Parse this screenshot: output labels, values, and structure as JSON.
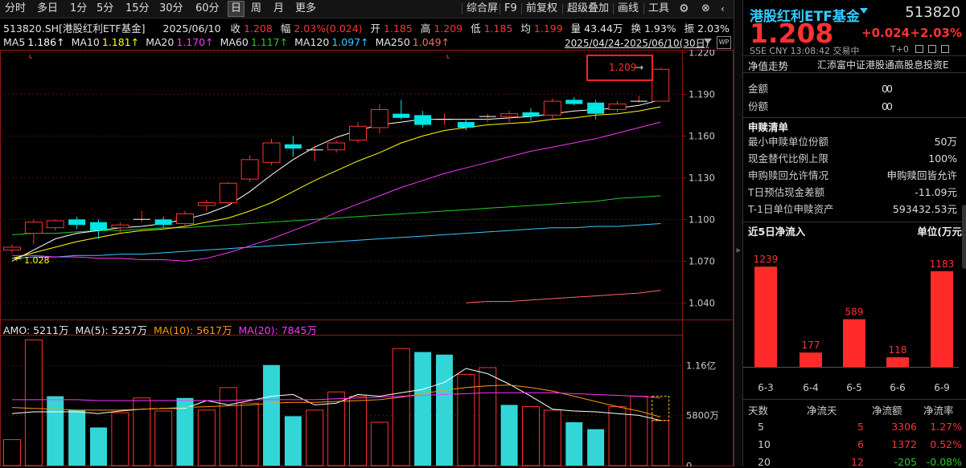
{
  "toolbar": {
    "periods": [
      "分时",
      "多日",
      "1分",
      "5分",
      "15分",
      "30分",
      "60分",
      "日",
      "周",
      "月",
      "更多"
    ],
    "active_period": "日",
    "tools": [
      "综合屏",
      "F9",
      "前复权",
      "超级叠加",
      "画线",
      "工具"
    ]
  },
  "header": {
    "code_name": "513820.SH[港股红利ETF基金]",
    "date": "2025/06/10",
    "close_label": "收",
    "close": "1.208",
    "change_label": "幅",
    "change": "2.03%(0.024)",
    "open_label": "开",
    "open": "1.185",
    "high_label": "高",
    "high": "1.209",
    "low_label": "低",
    "low": "1.185",
    "avg_label": "均",
    "avg": "1.199",
    "volume_label": "量",
    "volume": "43.44万",
    "turnover_label": "换",
    "turnover": "1.93%",
    "amplitude_label": "振",
    "amplitude": "2.03%",
    "date_range": "2025/04/24-2025/06/10(30日)"
  },
  "ma_legend": [
    {
      "label": "MA5",
      "value": "1.186↑",
      "color": "#ffffff"
    },
    {
      "label": "MA10",
      "value": "1.181↑",
      "color": "#ffff00"
    },
    {
      "label": "MA20",
      "value": "1.170↑",
      "color": "#ff33ff"
    },
    {
      "label": "MA60",
      "value": "1.117↑",
      "color": "#22cc22"
    },
    {
      "label": "MA120",
      "value": "1.097↑",
      "color": "#33ccff"
    },
    {
      "label": "MA250",
      "value": "1.049↑",
      "color": "#ff6666"
    }
  ],
  "price_axis": [
    "1.220",
    "1.190",
    "1.160",
    "1.130",
    "1.100",
    "1.070",
    "1.040"
  ],
  "annotations": {
    "high_marker": "1.209",
    "low_marker": "1.028"
  },
  "volume_legend": {
    "amo_label": "AMO:",
    "amo": "5211万",
    "ma5_label": "MA(5):",
    "ma5": "5257万",
    "ma10_label": "MA(10):",
    "ma10": "5617万",
    "ma20_label": "MA(20):",
    "ma20": "7845万"
  },
  "volume_axis": [
    "1.16亿",
    "5800万",
    "0"
  ],
  "chart_data": {
    "type": "candlestick",
    "ylim": [
      1.028,
      1.222
    ],
    "candles": [
      [
        1.078,
        1.08,
        1.076,
        1.082
      ],
      [
        1.09,
        1.098,
        1.082,
        1.1
      ],
      [
        1.094,
        1.099,
        1.092,
        1.1
      ],
      [
        1.1,
        1.096,
        1.093,
        1.102
      ],
      [
        1.098,
        1.092,
        1.086,
        1.1
      ],
      [
        1.094,
        1.096,
        1.09,
        1.098
      ],
      [
        1.1,
        1.1,
        1.098,
        1.106
      ],
      [
        1.1,
        1.096,
        1.094,
        1.102
      ],
      [
        1.097,
        1.104,
        1.095,
        1.106
      ],
      [
        1.11,
        1.112,
        1.106,
        1.114
      ],
      [
        1.112,
        1.126,
        1.11,
        1.127
      ],
      [
        1.129,
        1.143,
        1.127,
        1.146
      ],
      [
        1.141,
        1.155,
        1.139,
        1.158
      ],
      [
        1.154,
        1.151,
        1.145,
        1.16
      ],
      [
        1.15,
        1.15,
        1.142,
        1.153
      ],
      [
        1.15,
        1.155,
        1.148,
        1.157
      ],
      [
        1.157,
        1.167,
        1.155,
        1.17
      ],
      [
        1.166,
        1.179,
        1.162,
        1.183
      ],
      [
        1.176,
        1.173,
        1.172,
        1.186
      ],
      [
        1.175,
        1.168,
        1.166,
        1.178
      ],
      [
        1.172,
        1.172,
        1.168,
        1.176
      ],
      [
        1.17,
        1.166,
        1.164,
        1.172
      ],
      [
        1.174,
        1.174,
        1.17,
        1.176
      ],
      [
        1.174,
        1.176,
        1.17,
        1.178
      ],
      [
        1.177,
        1.174,
        1.171,
        1.18
      ],
      [
        1.175,
        1.185,
        1.172,
        1.187
      ],
      [
        1.186,
        1.183,
        1.182,
        1.188
      ],
      [
        1.184,
        1.176,
        1.172,
        1.186
      ],
      [
        1.179,
        1.183,
        1.177,
        1.185
      ],
      [
        1.185,
        1.185,
        1.184,
        1.189
      ],
      [
        1.185,
        1.208,
        1.185,
        1.209
      ]
    ],
    "ma5": [
      1.07,
      1.078,
      1.086,
      1.09,
      1.092,
      1.094,
      1.095,
      1.097,
      1.1,
      1.104,
      1.11,
      1.12,
      1.132,
      1.143,
      1.152,
      1.159,
      1.164,
      1.168,
      1.17,
      1.172,
      1.172,
      1.172,
      1.172,
      1.173,
      1.174,
      1.176,
      1.178,
      1.179,
      1.18,
      1.182,
      1.186
    ],
    "ma10": [
      1.072,
      1.076,
      1.08,
      1.084,
      1.087,
      1.09,
      1.092,
      1.093,
      1.095,
      1.098,
      1.101,
      1.106,
      1.112,
      1.12,
      1.128,
      1.135,
      1.142,
      1.148,
      1.155,
      1.16,
      1.164,
      1.166,
      1.168,
      1.169,
      1.17,
      1.172,
      1.173,
      1.175,
      1.176,
      1.178,
      1.181
    ],
    "ma20": [
      1.074,
      1.074,
      1.073,
      1.073,
      1.072,
      1.072,
      1.071,
      1.071,
      1.07,
      1.072,
      1.076,
      1.081,
      1.086,
      1.092,
      1.098,
      1.105,
      1.111,
      1.117,
      1.123,
      1.128,
      1.133,
      1.137,
      1.141,
      1.145,
      1.149,
      1.152,
      1.155,
      1.158,
      1.162,
      1.166,
      1.17
    ],
    "ma60": [
      1.089,
      1.09,
      1.09,
      1.091,
      1.092,
      1.092,
      1.093,
      1.094,
      1.094,
      1.095,
      1.096,
      1.097,
      1.098,
      1.099,
      1.1,
      1.101,
      1.102,
      1.103,
      1.104,
      1.105,
      1.106,
      1.107,
      1.108,
      1.109,
      1.11,
      1.111,
      1.112,
      1.113,
      1.115,
      1.116,
      1.117
    ],
    "ma120": [
      1.072,
      1.073,
      1.073,
      1.074,
      1.074,
      1.075,
      1.075,
      1.076,
      1.077,
      1.078,
      1.079,
      1.08,
      1.081,
      1.082,
      1.083,
      1.084,
      1.085,
      1.086,
      1.087,
      1.088,
      1.089,
      1.09,
      1.091,
      1.092,
      1.093,
      1.094,
      1.094,
      1.095,
      1.095,
      1.096,
      1.097
    ],
    "ma250": [
      null,
      null,
      null,
      null,
      null,
      null,
      null,
      null,
      null,
      null,
      null,
      null,
      null,
      null,
      null,
      null,
      null,
      null,
      null,
      null,
      null,
      1.04,
      1.041,
      1.041,
      1.042,
      1.043,
      1.044,
      1.045,
      1.046,
      1.047,
      1.049
    ],
    "volume": {
      "ylim": [
        0,
        150000000
      ],
      "values": [
        30000000,
        145000000,
        80000000,
        64000000,
        44000000,
        61000000,
        78000000,
        63000000,
        78000000,
        64000000,
        90000000,
        72000000,
        116000000,
        57000000,
        64000000,
        85000000,
        80000000,
        50000000,
        135000000,
        131000000,
        128000000,
        105000000,
        113000000,
        70000000,
        68000000,
        64000000,
        50000000,
        42000000,
        68000000,
        80000000,
        52000000
      ],
      "up": [
        true,
        true,
        false,
        false,
        false,
        true,
        true,
        true,
        false,
        true,
        true,
        true,
        false,
        false,
        true,
        true,
        true,
        true,
        true,
        false,
        false,
        true,
        true,
        false,
        true,
        true,
        false,
        false,
        true,
        true,
        true
      ],
      "ma5": [
        60000000,
        62000000,
        62000000,
        62000000,
        60000000,
        63000000,
        65000000,
        66000000,
        66000000,
        75000000,
        70000000,
        75000000,
        80000000,
        82000000,
        70000000,
        72000000,
        82000000,
        80000000,
        84000000,
        88000000,
        96000000,
        112000000,
        106000000,
        94000000,
        80000000,
        65000000,
        63000000,
        62000000,
        60000000,
        58000000,
        52000000
      ],
      "ma10": [
        67000000,
        66000000,
        65000000,
        64000000,
        64000000,
        64000000,
        65000000,
        66000000,
        67000000,
        68000000,
        69000000,
        70000000,
        72000000,
        73000000,
        73000000,
        74000000,
        75000000,
        76000000,
        79000000,
        83000000,
        87000000,
        90000000,
        92000000,
        93000000,
        90000000,
        86000000,
        80000000,
        74000000,
        68000000,
        63000000,
        56000000
      ],
      "ma20": [
        76000000,
        76000000,
        76000000,
        76000000,
        75000000,
        75000000,
        75000000,
        75000000,
        75000000,
        75000000,
        75000000,
        76000000,
        76000000,
        76000000,
        76000000,
        77000000,
        78000000,
        79000000,
        80000000,
        81000000,
        82000000,
        83000000,
        84000000,
        84000000,
        84000000,
        84000000,
        83000000,
        82000000,
        81000000,
        80000000,
        78000000
      ]
    }
  },
  "right": {
    "title": "港股红利ETF基金",
    "code": "513820",
    "price": "1.208",
    "change": "+0.024",
    "change_pct": "+2.03%",
    "exchange": "SSE",
    "currency": "CNY",
    "time": "13:08:42",
    "status": "交易中",
    "t0": "T+0",
    "tab_nav": "净值走势",
    "index_name": "汇添富中证港股通高股息投资E",
    "rows_top": [
      {
        "label": "金额",
        "value": "0",
        "value2": "0"
      },
      {
        "label": "份额",
        "value": "0",
        "value2": "0"
      }
    ],
    "subscribe_title": "申赎清单",
    "subscribe_rows": [
      {
        "label": "最小申赎单位份额",
        "value": "50万"
      },
      {
        "label": "现金替代比例上限",
        "value": "100%"
      },
      {
        "label": "申购赎回允许情况",
        "value": "申购赎回皆允许"
      },
      {
        "label": "T日预估现金差额",
        "value": "-11.09元"
      },
      {
        "label": "T-1日单位申赎资产",
        "value": "593432.53元"
      }
    ],
    "inflow_title": "近5日净流入",
    "inflow_unit": "单位(万元",
    "inflow_chart": {
      "type": "bar",
      "categories": [
        "6-3",
        "6-4",
        "6-5",
        "6-6",
        "6-9"
      ],
      "values": [
        1239,
        177,
        589,
        118,
        1183
      ]
    },
    "table_headers": [
      "天数",
      "净流天",
      "净流额",
      "净流率"
    ],
    "table_rows": [
      [
        "5",
        "5",
        "3306",
        "1.27%"
      ],
      [
        "10",
        "6",
        "1372",
        "0.52%"
      ],
      [
        "20",
        "12",
        "-205",
        "-0.08%"
      ]
    ]
  }
}
